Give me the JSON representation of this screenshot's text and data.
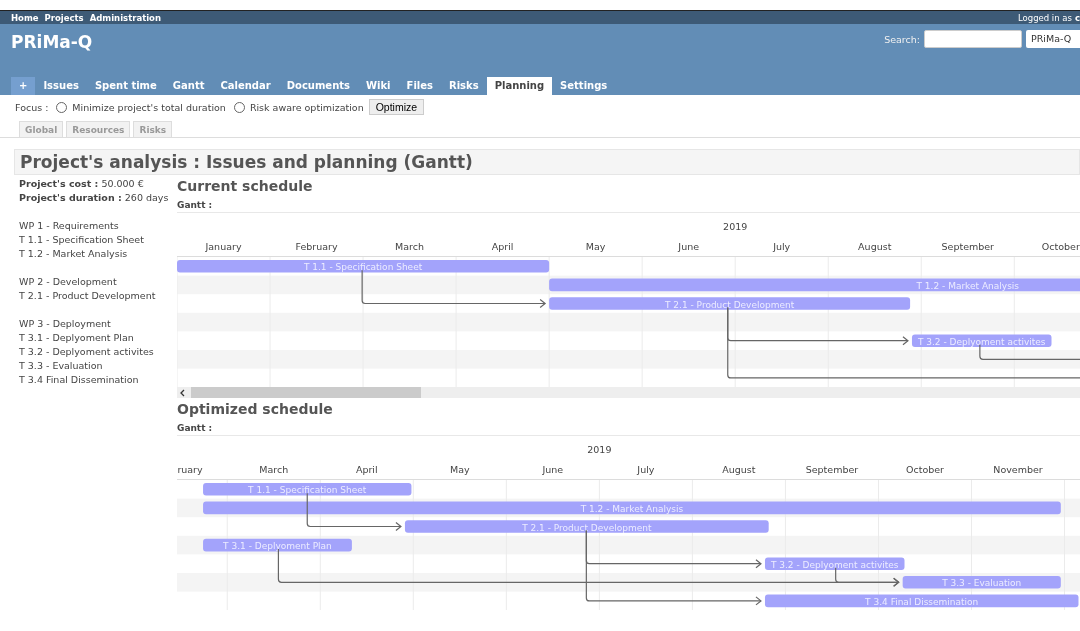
{
  "top_menu": {
    "links": [
      "Home",
      "Projects",
      "Administration"
    ],
    "logged_in_label": "Logged in as",
    "user": "c"
  },
  "header": {
    "project_title": "PRiMa-Q",
    "search_label": "Search:",
    "search": {
      "kind": "field"
    },
    "project_select": {
      "value": "PRiMa-Q"
    }
  },
  "tabs": [
    {
      "label": "+",
      "kind": "new",
      "selected": false
    },
    {
      "label": "Issues",
      "kind": "tab",
      "selected": false
    },
    {
      "label": "Spent time",
      "kind": "tab",
      "selected": false
    },
    {
      "label": "Gantt",
      "kind": "tab",
      "selected": false
    },
    {
      "label": "Calendar",
      "kind": "tab",
      "selected": false
    },
    {
      "label": "Documents",
      "kind": "tab",
      "selected": false
    },
    {
      "label": "Wiki",
      "kind": "tab",
      "selected": false
    },
    {
      "label": "Files",
      "kind": "tab",
      "selected": false
    },
    {
      "label": "Risks",
      "kind": "tab",
      "selected": false
    },
    {
      "label": "Planning",
      "kind": "tab",
      "selected": true
    },
    {
      "label": "Settings",
      "kind": "tab",
      "selected": false
    }
  ],
  "focus": {
    "label": "Focus :",
    "options": [
      {
        "label": "Minimize project's total duration",
        "checked": false
      },
      {
        "label": "Risk aware optimization",
        "checked": false
      }
    ],
    "button": "Optimize"
  },
  "sub_tabs": [
    {
      "label": "Global",
      "selected": false
    },
    {
      "label": "Resources",
      "selected": false
    },
    {
      "label": "Risks",
      "selected": false
    }
  ],
  "page_title": "Project's analysis : Issues and planning (Gantt)",
  "summary": [
    {
      "label": "Project's cost :",
      "value": "50.000 €"
    },
    {
      "label": "Project's duration :",
      "value": "260 days"
    }
  ],
  "work_packages": [
    [
      "WP 1 - Requirements",
      "T 1.1 - Specification Sheet",
      "T 1.2 - Market Analysis"
    ],
    [
      "WP 2 - Development",
      "T 2.1 - Product Development"
    ],
    [
      "WP 3 - Deployment",
      "T 3.1 - Deplyoment Plan",
      "T 3.2 - Deplyoment activites",
      "T 3.3 - Evaluation",
      "T 3.4 Final Dissemination"
    ]
  ],
  "schedules": [
    {
      "title": "Current schedule",
      "gantt_label": "Gantt :",
      "scrollbar": true,
      "gantt": {
        "year": "2019",
        "months": [
          "January",
          "February",
          "March",
          "April",
          "May",
          "June",
          "July",
          "August",
          "September",
          "October"
        ],
        "bars": [
          {
            "label": "T 1.1 - Specification Sheet"
          },
          {
            "label": "T 1.2 - Market Analysis"
          },
          {
            "label": "T 2.1 - Product Development"
          },
          {
            "label": "T 3.2 - Deplyoment activites"
          }
        ]
      }
    },
    {
      "title": "Optimized schedule",
      "gantt_label": "Gantt :",
      "scrollbar": false,
      "gantt": {
        "year": "2019",
        "months": [
          "ruary",
          "March",
          "April",
          "May",
          "June",
          "July",
          "August",
          "September",
          "October",
          "November"
        ],
        "bars": [
          {
            "label": "T 1.1 - Specification Sheet"
          },
          {
            "label": "T 1.2 - Market Analysis"
          },
          {
            "label": "T 2.1 - Product Development"
          },
          {
            "label": "T 3.1 - Deplyoment Plan"
          },
          {
            "label": "T 3.2 - Deplyoment activites"
          },
          {
            "label": "T 3.3 - Evaluation"
          },
          {
            "label": "T 3.4 Final Dissemination"
          }
        ]
      }
    }
  ]
}
